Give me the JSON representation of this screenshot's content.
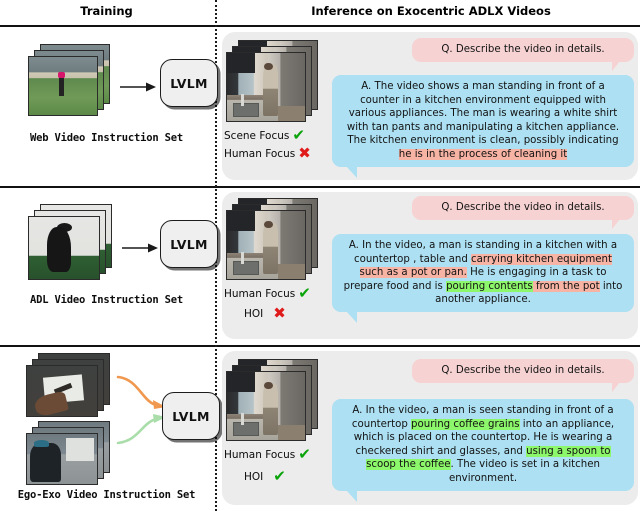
{
  "header": {
    "training_title": "Training",
    "inference_title": "Inference on Exocentric ADLX Videos"
  },
  "model_label": "LVLM",
  "question": "Q. Describe the video in details.",
  "rows": [
    {
      "id": "web-video",
      "set_label": "Web Video Instruction Set",
      "focus": [
        {
          "label": "Scene  Focus",
          "mark": "check"
        },
        {
          "label": "Human Focus",
          "mark": "cross"
        }
      ],
      "answer_prefix": "A. The video shows a man standing in front of a counter in a kitchen environment equipped with various appliances. The man is wearing a white shirt with tan pants and manipulating a kitchen appliance. The kitchen environment is clean, possibly indicating ",
      "answer_segments": [
        {
          "text": "A. The video shows a man standing in front of a counter in a kitchen environment equipped with various appliances. The man is wearing a white shirt with tan pants and manipulating a kitchen appliance. The kitchen environment is clean, possibly indicating ",
          "highlight": "none"
        },
        {
          "text": "he is in the process of cleaning it",
          "highlight": "red"
        }
      ]
    },
    {
      "id": "adl-video",
      "set_label": "ADL Video Instruction Set",
      "focus": [
        {
          "label": "Human Focus",
          "mark": "check"
        },
        {
          "label": "HOI",
          "mark": "cross"
        }
      ],
      "answer_segments": [
        {
          "text": "A. In the video, a man is standing in a kitchen with a countertop , table and ",
          "highlight": "none"
        },
        {
          "text": "carrying kitchen equipment such as a pot or pan.",
          "highlight": "red"
        },
        {
          "text": " He is engaging in a task to prepare food and is ",
          "highlight": "none"
        },
        {
          "text": "pouring contents",
          "highlight": "green"
        },
        {
          "text": " from the ",
          "highlight": "red"
        },
        {
          "text": "pot",
          "highlight": "red"
        },
        {
          "text": " into another appliance.",
          "highlight": "none"
        }
      ]
    },
    {
      "id": "ego-exo-video",
      "set_label": "Ego-Exo Video Instruction Set",
      "focus": [
        {
          "label": "Human Focus",
          "mark": "check"
        },
        {
          "label": "HOI",
          "mark": "check"
        }
      ],
      "answer_segments": [
        {
          "text": "A. In the video, a man is seen standing in front of a countertop ",
          "highlight": "none"
        },
        {
          "text": "pouring coffee grains",
          "highlight": "green"
        },
        {
          "text": " into an appliance, which is placed on the countertop. He is wearing a checkered shirt and glasses, and ",
          "highlight": "none"
        },
        {
          "text": "using a spoon to scoop the coffee",
          "highlight": "green"
        },
        {
          "text": ". The video is set in a kitchen environment.",
          "highlight": "none"
        }
      ]
    }
  ],
  "colors": {
    "question_bubble": "#f6d2d2",
    "answer_bubble": "#ace0f2",
    "highlight_red": "#f7b3a4",
    "highlight_green": "#8cf76a",
    "check_mark": "#0aa30a",
    "cross_mark": "#e01b1b",
    "panel": "#ececec",
    "ego_arrow": "#f0984f",
    "exo_arrow": "#a9dda9"
  },
  "marks": {
    "check": "✔",
    "cross": "✖"
  }
}
